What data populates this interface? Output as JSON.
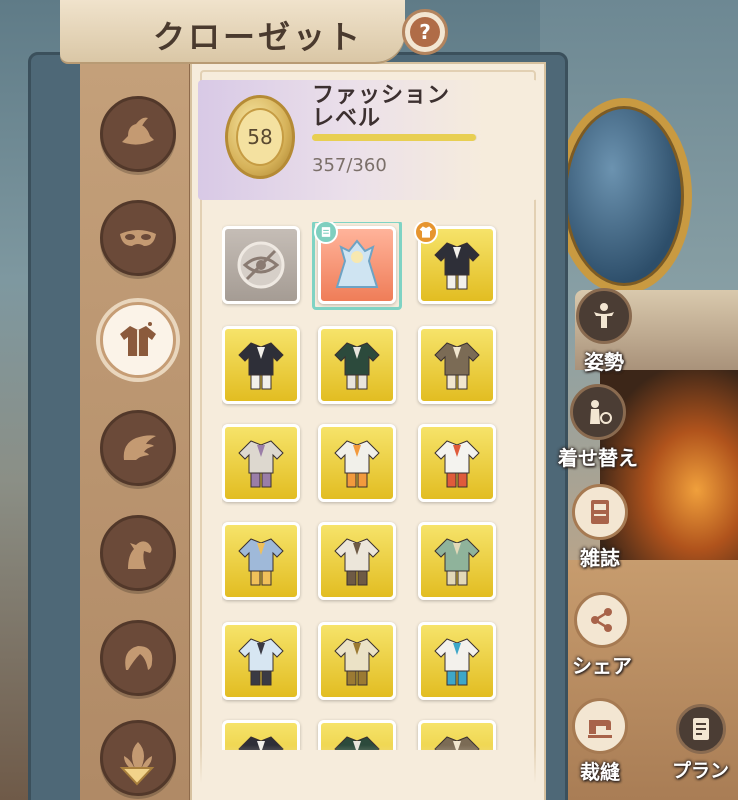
{
  "header": {
    "title": "クローゼット",
    "help_icon": "question-icon",
    "help_symbol": "?"
  },
  "categories": [
    {
      "name": "hat",
      "icon": "hat-icon",
      "active": false
    },
    {
      "name": "mask",
      "icon": "mask-icon",
      "active": false
    },
    {
      "name": "outfit",
      "icon": "jacket-icon",
      "active": true
    },
    {
      "name": "wings",
      "icon": "wing-icon",
      "active": false
    },
    {
      "name": "mount",
      "icon": "horse-icon",
      "active": false
    },
    {
      "name": "hair",
      "icon": "hair-icon",
      "active": false
    },
    {
      "name": "more",
      "icon": "leaf-icon",
      "active": false
    }
  ],
  "fashion": {
    "level": "58",
    "label": "ファッションレベル",
    "progress_text": "357/360",
    "progress_fraction": 0.9917
  },
  "items": [
    {
      "type": "none",
      "icon": "hidden-eye-icon"
    },
    {
      "type": "special",
      "icon": "outfit-icon",
      "selected": true,
      "badge": "note-icon"
    },
    {
      "type": "gold",
      "icon": "outfit-icon",
      "badge": "shirt-icon"
    },
    {
      "type": "gold",
      "icon": "outfit-icon"
    },
    {
      "type": "gold",
      "icon": "outfit-icon"
    },
    {
      "type": "gold",
      "icon": "outfit-icon"
    },
    {
      "type": "gold",
      "icon": "outfit-icon"
    },
    {
      "type": "gold",
      "icon": "outfit-icon"
    },
    {
      "type": "gold",
      "icon": "outfit-icon"
    },
    {
      "type": "gold",
      "icon": "outfit-icon"
    },
    {
      "type": "gold",
      "icon": "outfit-icon"
    },
    {
      "type": "gold",
      "icon": "outfit-icon"
    },
    {
      "type": "gold",
      "icon": "outfit-icon"
    },
    {
      "type": "gold",
      "icon": "outfit-icon"
    },
    {
      "type": "gold",
      "icon": "outfit-icon"
    },
    {
      "type": "gold",
      "icon": "outfit-icon"
    },
    {
      "type": "gold",
      "icon": "outfit-icon"
    },
    {
      "type": "gold",
      "icon": "outfit-icon"
    }
  ],
  "actions": {
    "pose": "姿勢",
    "change": "着せ替え",
    "magazine": "雑誌",
    "share": "シェア",
    "sewing": "裁縫",
    "plan": "プラン"
  },
  "colors": {
    "item_gold": "#e9c52e",
    "item_special": "#f08a64",
    "selection": "#7fd3c4",
    "category_active": "#fbf3e8",
    "category_inactive": "#6b4a39"
  }
}
